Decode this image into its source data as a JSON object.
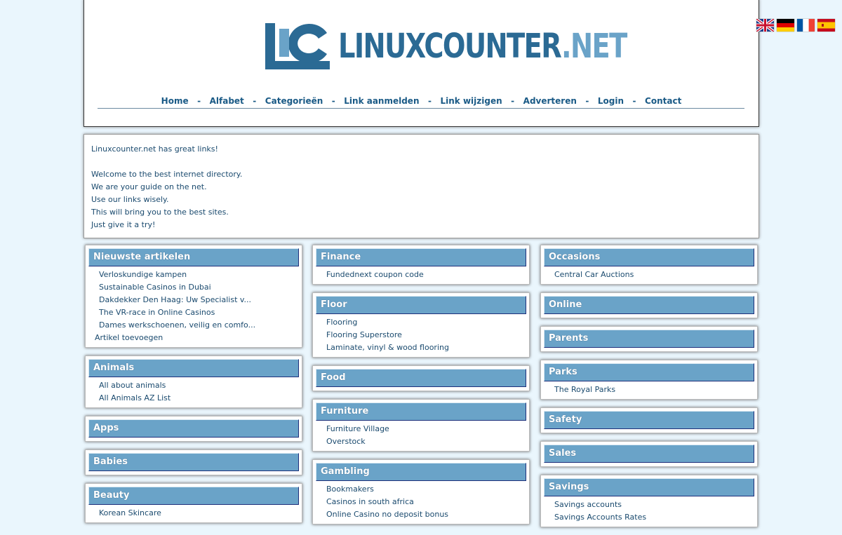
{
  "header": {
    "logo_main": "LINUXCOUNTER",
    "logo_tld": ".NET",
    "nav": [
      {
        "label": "Home"
      },
      {
        "label": "Alfabet"
      },
      {
        "label": "Categorieën"
      },
      {
        "label": "Link aanmelden"
      },
      {
        "label": "Link wijzigen"
      },
      {
        "label": "Adverteren"
      },
      {
        "label": "Login"
      },
      {
        "label": "Contact"
      }
    ],
    "nav_separator": "-"
  },
  "flags": [
    "uk-flag-icon",
    "germany-flag-icon",
    "france-flag-icon",
    "spain-flag-icon"
  ],
  "colors": {
    "background": "#eaf6fd",
    "title_bar": "#6aa3c8",
    "text": "#1a4a6e",
    "logo_dark": "#2b6a94",
    "logo_light": "#6aa3c8"
  },
  "intro": {
    "line1": "Linuxcounter.net has great links!",
    "line2": "Welcome to the best internet directory.",
    "line3": "We are your guide on the net.",
    "line4": "Use our links wisely.",
    "line5": "This will bring you to the best sites.",
    "line6": "Just give it a try!"
  },
  "columns": {
    "col1": [
      {
        "title": "Nieuwste artikelen",
        "items": [
          "Verloskundige kampen",
          "Sustainable Casinos in Dubai",
          "Dakdekker Den Haag: Uw Specialist v...",
          "The VR-race in Online Casinos",
          "Dames werkschoenen, veilig en comfo..."
        ],
        "extra": "Artikel toevoegen"
      },
      {
        "title": "Animals",
        "items": [
          "All about animals",
          "All Animals AZ List"
        ]
      },
      {
        "title": "Apps",
        "items": []
      },
      {
        "title": "Babies",
        "items": []
      },
      {
        "title": "Beauty",
        "items": [
          "Korean Skincare"
        ]
      }
    ],
    "col2": [
      {
        "title": "Finance",
        "items": [
          "Fundednext coupon code"
        ]
      },
      {
        "title": "Floor",
        "items": [
          "Flooring",
          "Flooring Superstore",
          "Laminate, vinyl & wood flooring"
        ]
      },
      {
        "title": "Food",
        "items": []
      },
      {
        "title": "Furniture",
        "items": [
          "Furniture Village",
          "Overstock"
        ]
      },
      {
        "title": "Gambling",
        "items": [
          "Bookmakers",
          "Casinos in south africa",
          "Online Casino no deposit bonus"
        ]
      }
    ],
    "col3": [
      {
        "title": "Occasions",
        "items": [
          "Central Car Auctions"
        ]
      },
      {
        "title": "Online",
        "items": []
      },
      {
        "title": "Parents",
        "items": []
      },
      {
        "title": "Parks",
        "items": [
          "The Royal Parks"
        ]
      },
      {
        "title": "Safety",
        "items": []
      },
      {
        "title": "Sales",
        "items": []
      },
      {
        "title": "Savings",
        "items": [
          "Savings accounts",
          "Savings Accounts Rates"
        ]
      }
    ]
  }
}
